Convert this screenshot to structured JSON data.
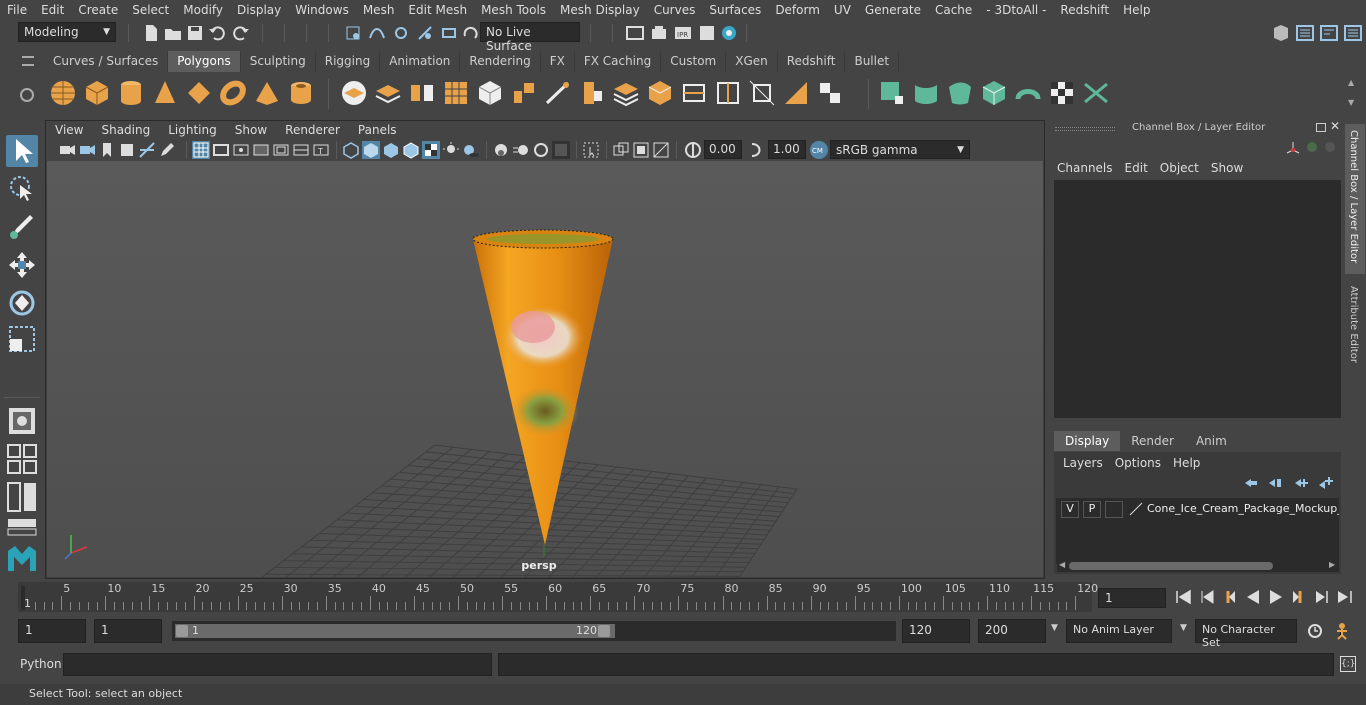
{
  "menubar": {
    "items": [
      "File",
      "Edit",
      "Create",
      "Select",
      "Modify",
      "Display",
      "Windows",
      "Mesh",
      "Edit Mesh",
      "Mesh Tools",
      "Mesh Display",
      "Curves",
      "Surfaces",
      "Deform",
      "UV",
      "Generate",
      "Cache",
      "- 3DtoAll -",
      "Redshift",
      "Help"
    ]
  },
  "statusline": {
    "mode": "Modeling",
    "live_surface": "No Live Surface"
  },
  "shelf": {
    "tabs": [
      "Curves / Surfaces",
      "Polygons",
      "Sculpting",
      "Rigging",
      "Animation",
      "Rendering",
      "FX",
      "FX Caching",
      "Custom",
      "XGen",
      "Redshift",
      "Bullet"
    ],
    "active_tab": "Polygons"
  },
  "viewport": {
    "menu": [
      "View",
      "Shading",
      "Lighting",
      "Show",
      "Renderer",
      "Panels"
    ],
    "exposure": "0.00",
    "gamma": "1.00",
    "color_space": "sRGB gamma",
    "camera_label": "persp"
  },
  "channelbox": {
    "title": "Channel Box / Layer Editor",
    "menu": [
      "Channels",
      "Edit",
      "Object",
      "Show"
    ]
  },
  "layereditor": {
    "tabs": [
      "Display",
      "Render",
      "Anim"
    ],
    "active_tab": "Display",
    "menu": [
      "Layers",
      "Options",
      "Help"
    ],
    "layer": {
      "v": "V",
      "p": "P",
      "name": "Cone_Ice_Cream_Package_Mockup_Tr"
    }
  },
  "sidetabs": [
    "Channel Box / Layer Editor",
    "Attribute Editor"
  ],
  "timeline": {
    "ticks": [
      "5",
      "10",
      "15",
      "20",
      "25",
      "30",
      "35",
      "40",
      "45",
      "50",
      "55",
      "60",
      "65",
      "70",
      "75",
      "80",
      "85",
      "90",
      "95",
      "100",
      "105",
      "110",
      "115",
      "120"
    ],
    "start_marker": "1",
    "current_frame": "1"
  },
  "range": {
    "start": "1",
    "playback_start": "1",
    "slider_start": "1",
    "slider_end": "120",
    "playback_end": "120",
    "end": "200",
    "anim_layer": "No Anim Layer",
    "character_set": "No Character Set"
  },
  "cmdline": {
    "label": "Python"
  },
  "helpline": {
    "text": "Select Tool: select an object"
  },
  "colors": {
    "accent": "#5285a6",
    "shelf_orange": "#e8a24a",
    "shelf_green": "#5fb89a",
    "cone": "#e8901c"
  }
}
